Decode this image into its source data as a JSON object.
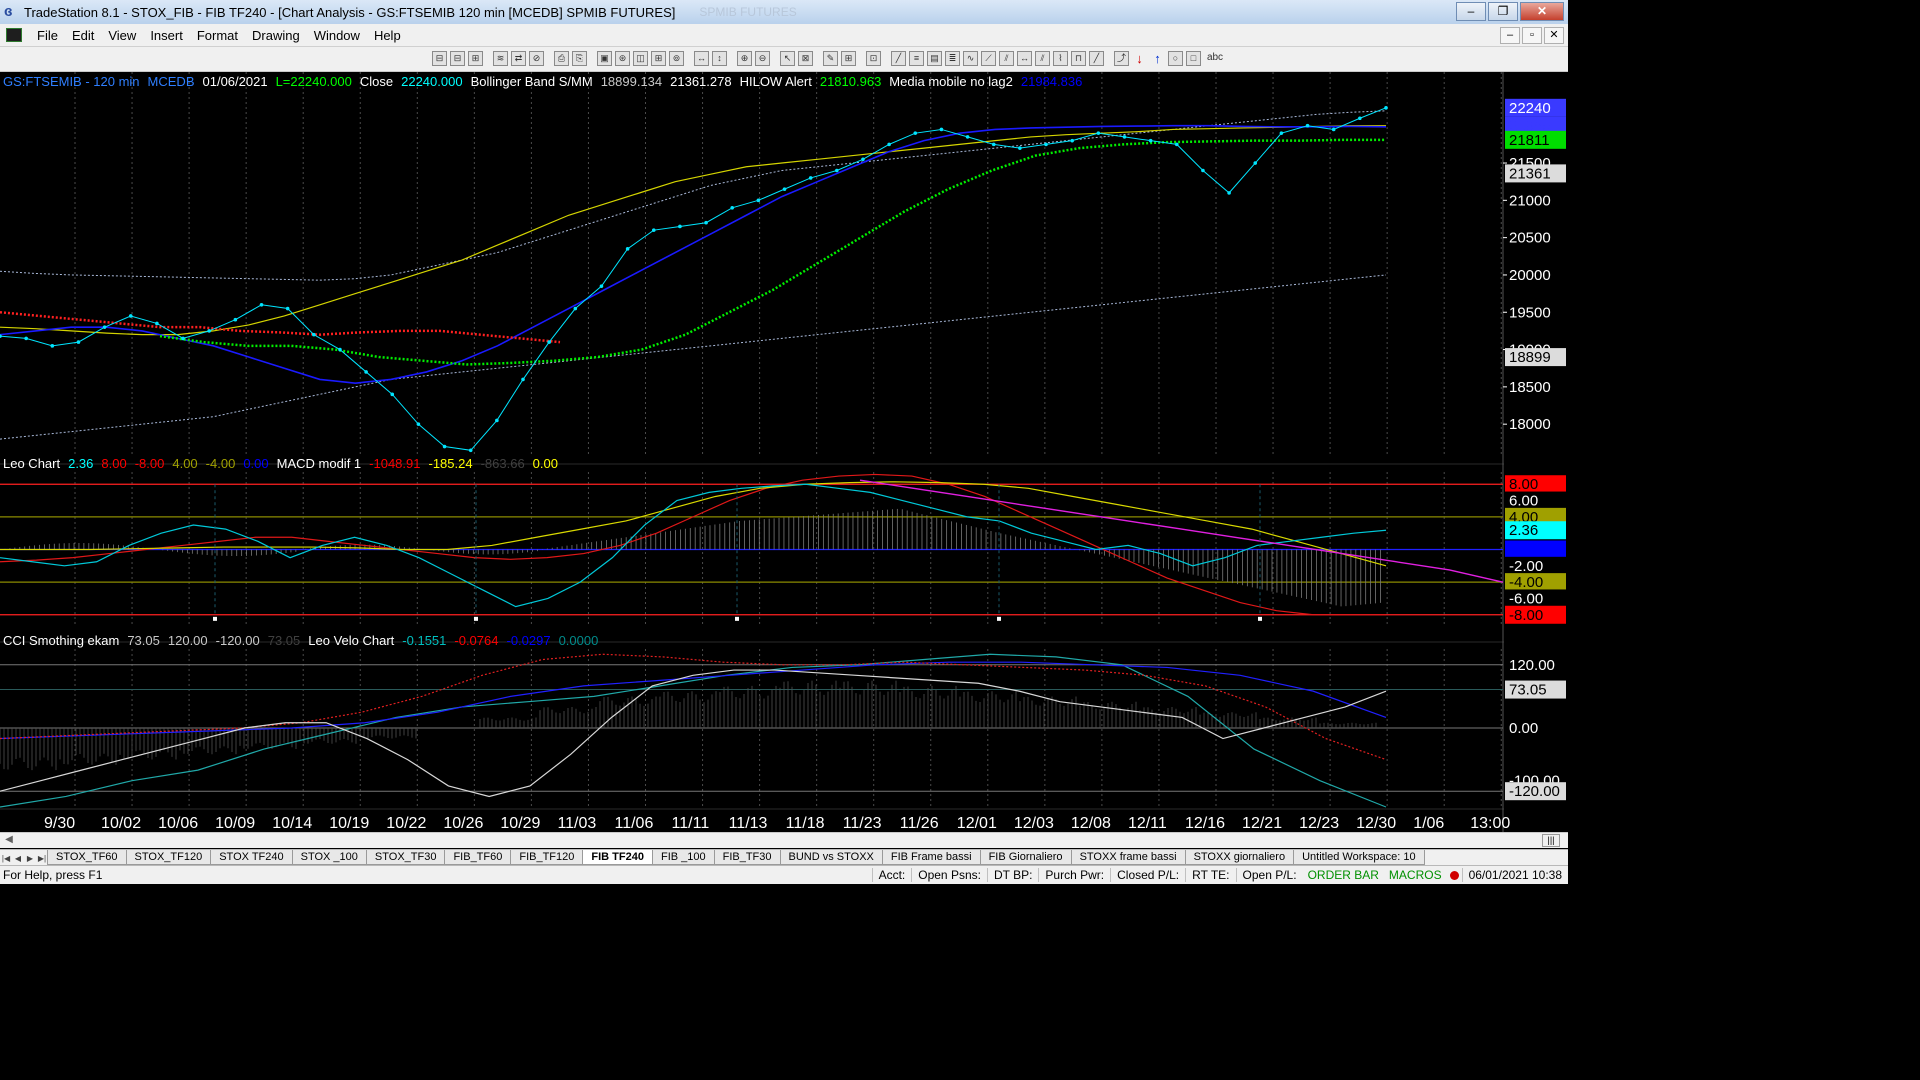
{
  "window": {
    "title": "TradeStation 8.1 - STOX_FIB - FIB TF240 - [Chart Analysis - GS:FTSEMIB  120 min  [MCEDB] SPMIB FUTURES]",
    "ghost_text": "SPMIB FUTURES",
    "min": "–",
    "max": "❐",
    "close": "✕"
  },
  "menu": {
    "items": [
      "File",
      "Edit",
      "View",
      "Insert",
      "Format",
      "Drawing",
      "Window",
      "Help"
    ],
    "mdi": [
      "–",
      "▫",
      "✕"
    ]
  },
  "toolbar": {
    "icons": [
      "⊟",
      "⊟",
      "⊞",
      "sep",
      "≋",
      "⇄",
      "⊘",
      "sep",
      "⎙",
      "⎘",
      "sep",
      "▣",
      "⊛",
      "◫",
      "⊞",
      "⊚",
      "sep",
      "↔",
      "↕",
      "sep",
      "⊕",
      "⊖",
      "sep",
      "↖",
      "⊠",
      "sep",
      "✎",
      "⊞",
      "sep",
      "⊡",
      "sep",
      "╱",
      "≡",
      "▤",
      "≣",
      "∿",
      "⟋",
      "⫽",
      "↔",
      "⫽",
      "⌇",
      "⊓",
      "╱",
      "sep",
      "⤴",
      "↓",
      "↑",
      "○",
      "□",
      "abc"
    ]
  },
  "price_panel": {
    "header": [
      {
        "text": "GS:FTSEMIB - 120 min",
        "color": "#2f7fff"
      },
      {
        "text": "MCEDB",
        "color": "#2f7fff"
      },
      {
        "text": "01/06/2021",
        "color": "#ffffff"
      },
      {
        "text": "L=22240.000",
        "color": "#00ff00"
      },
      {
        "text": "Close",
        "color": "#ffffff"
      },
      {
        "text": "22240.000",
        "color": "#00ffff"
      },
      {
        "text": "Bollinger Band S/MM",
        "color": "#ffffff"
      },
      {
        "text": "18899.134",
        "color": "#c8c8c8"
      },
      {
        "text": "21361.278",
        "color": "#ffffff"
      },
      {
        "text": "HILOW Alert",
        "color": "#ffffff"
      },
      {
        "text": "21810.963",
        "color": "#00ff00"
      },
      {
        "text": "Media mobile no lag2",
        "color": "#ffffff"
      },
      {
        "text": "21984.836",
        "color": "#0000ff"
      }
    ],
    "y_ticks": [
      "21500",
      "21000",
      "20500",
      "20000",
      "19500",
      "19000",
      "18500",
      "18000"
    ],
    "y_ticks_vals": [
      21500,
      21000,
      20500,
      20000,
      19500,
      19000,
      18500,
      18000
    ],
    "y_range": [
      17560,
      22720
    ],
    "flags": [
      {
        "text": "22240",
        "bg": "#3a3aff",
        "fg": "#ffffff",
        "v": 22240
      },
      {
        "text": "21985",
        "bg": "#3a3aff",
        "fg": "#3a3aff",
        "v": 22000
      },
      {
        "text": "21811",
        "bg": "#00dd00",
        "fg": "#000000",
        "v": 21811
      },
      {
        "text": "21361",
        "bg": "#dcdcdc",
        "fg": "#000000",
        "v": 21361
      },
      {
        "text": "18899",
        "bg": "#dcdcdc",
        "fg": "#000000",
        "v": 18899
      }
    ]
  },
  "osc_panel": {
    "header": [
      {
        "text": "Leo Chart",
        "color": "#ffffff"
      },
      {
        "text": "2.36",
        "color": "#00ffff"
      },
      {
        "text": "8.00",
        "color": "#ff0000"
      },
      {
        "text": "-8.00",
        "color": "#ff0000"
      },
      {
        "text": "4.00",
        "color": "#a0a000"
      },
      {
        "text": "-4.00",
        "color": "#a0a000"
      },
      {
        "text": "0.00",
        "color": "#0000ff"
      },
      {
        "text": "MACD modif 1",
        "color": "#ffffff"
      },
      {
        "text": "-1048.91",
        "color": "#ff0000"
      },
      {
        "text": "-185.24",
        "color": "#ffff00"
      },
      {
        "text": "-863.66",
        "color": "#404040"
      },
      {
        "text": "0.00",
        "color": "#ffff00"
      }
    ],
    "y_range": [
      -9.5,
      9.5
    ],
    "flags": [
      {
        "text": "8.00",
        "bg": "#ff0000",
        "fg": "#000000",
        "v": 8
      },
      {
        "text": "6.00",
        "bg": "#000000",
        "fg": "#ffffff",
        "v": 6
      },
      {
        "text": "4.00",
        "bg": "#a0a000",
        "fg": "#000000",
        "v": 4
      },
      {
        "text": "2.36",
        "bg": "#00ffff",
        "fg": "#000000",
        "v": 2.36
      },
      {
        "text": "0.00",
        "bg": "#0000ff",
        "fg": "#0000ff",
        "v": 0
      },
      {
        "text": "-2.00",
        "bg": "#000000",
        "fg": "#ffffff",
        "v": -2
      },
      {
        "text": "-4.00",
        "bg": "#a0a000",
        "fg": "#000000",
        "v": -4
      },
      {
        "text": "-6.00",
        "bg": "#000000",
        "fg": "#ffffff",
        "v": -6
      },
      {
        "text": "-8.00",
        "bg": "#ff0000",
        "fg": "#000000",
        "v": -8
      }
    ]
  },
  "cci_panel": {
    "header": [
      {
        "text": "CCI Smothing ekam",
        "color": "#ffffff"
      },
      {
        "text": "73.05",
        "color": "#c8c8c8"
      },
      {
        "text": "120.00",
        "color": "#c8c8c8"
      },
      {
        "text": "-120.00",
        "color": "#c8c8c8"
      },
      {
        "text": "73.05",
        "color": "#404040"
      },
      {
        "text": "Leo Velo Chart",
        "color": "#ffffff"
      },
      {
        "text": "-0.1551",
        "color": "#00bfbf"
      },
      {
        "text": "-0.0764",
        "color": "#ff0000"
      },
      {
        "text": "-0.0297",
        "color": "#0000ff"
      },
      {
        "text": "0.0000",
        "color": "#008b8b"
      }
    ],
    "y_range": [
      -150,
      150
    ],
    "flags": [
      {
        "text": "120.00",
        "bg": "#000000",
        "fg": "#ffffff",
        "v": 120
      },
      {
        "text": "73.05",
        "bg": "#dcdcdc",
        "fg": "#000000",
        "v": 73
      },
      {
        "text": "0.00",
        "bg": "#000000",
        "fg": "#ffffff",
        "v": 0
      },
      {
        "text": "-100.00",
        "bg": "#000000",
        "fg": "#ffffff",
        "v": -100
      },
      {
        "text": "-120.00",
        "bg": "#dcdcdc",
        "fg": "#000000",
        "v": -120
      }
    ]
  },
  "x_axis": {
    "labels": [
      "9/30",
      "10/02",
      "10/06",
      "10/09",
      "10/14",
      "10/19",
      "10/22",
      "10/26",
      "10/29",
      "11/03",
      "11/06",
      "11/11",
      "11/13",
      "11/18",
      "11/23",
      "11/26",
      "12/01",
      "12/03",
      "12/08",
      "12/11",
      "12/16",
      "12/21",
      "12/23",
      "12/30",
      "1/06",
      "13:00"
    ]
  },
  "series": {
    "close": [
      19180,
      19150,
      19050,
      19100,
      19300,
      19450,
      19350,
      19150,
      19250,
      19400,
      19600,
      19550,
      19200,
      19000,
      18700,
      18400,
      18000,
      17700,
      17650,
      18050,
      18600,
      19100,
      19550,
      19850,
      20350,
      20600,
      20650,
      20700,
      20900,
      21000,
      21150,
      21300,
      21400,
      21550,
      21750,
      21900,
      21950,
      21850,
      21750,
      21700,
      21750,
      21800,
      21900,
      21850,
      21800,
      21750,
      21400,
      21100,
      21500,
      21900,
      22000,
      21950,
      22100,
      22240
    ],
    "bb_mid": [
      19300,
      19280,
      19250,
      19220,
      19200,
      19200,
      19250,
      19330,
      19450,
      19600,
      19750,
      19900,
      20050,
      20200,
      20400,
      20600,
      20800,
      20950,
      21100,
      21250,
      21350,
      21450,
      21500,
      21550,
      21600,
      21650,
      21700,
      21750,
      21800,
      21850,
      21880,
      21900,
      21920,
      21950,
      21960,
      21970,
      21980,
      21990,
      22000,
      22000
    ],
    "bb_low": [
      17800,
      17850,
      17900,
      17950,
      18000,
      18050,
      18100,
      18200,
      18300,
      18400,
      18500,
      18600,
      18650,
      18700,
      18750,
      18800,
      18850,
      18900,
      18950,
      19000,
      19050,
      19100,
      19150,
      19200,
      19250,
      19300,
      19350,
      19400,
      19450,
      19500,
      19550,
      19600,
      19650,
      19700,
      19750,
      19800,
      19850,
      19900,
      19950,
      20000
    ],
    "bb_up": [
      20050,
      20020,
      20000,
      19990,
      19980,
      19970,
      19960,
      19950,
      19940,
      19930,
      19950,
      20000,
      20100,
      20200,
      20300,
      20450,
      20600,
      20750,
      20900,
      21050,
      21200,
      21300,
      21400,
      21450,
      21500,
      21550,
      21600,
      21650,
      21700,
      21750,
      21800,
      21850,
      21900,
      21950,
      22000,
      22050,
      22100,
      22150,
      22180,
      22200
    ],
    "mm_nolag": [
      19200,
      19250,
      19300,
      19300,
      19250,
      19150,
      19050,
      18900,
      18750,
      18600,
      18550,
      18600,
      18700,
      18850,
      19050,
      19300,
      19550,
      19800,
      20050,
      20300,
      20550,
      20800,
      21050,
      21250,
      21450,
      21650,
      21800,
      21900,
      21950,
      21970,
      21980,
      21990,
      21995,
      22000,
      22000,
      21990,
      21985,
      21985,
      21990,
      21985
    ],
    "hilow_red": [
      19500,
      19450,
      19400,
      19350,
      19300,
      19300,
      19250,
      19230,
      19200,
      19230,
      19250,
      19250,
      19200,
      19150,
      19100
    ],
    "hilow_green": [
      19180,
      19100,
      19050,
      19050,
      19000,
      18900,
      18850,
      18800,
      18820,
      18850,
      18900,
      19000,
      19200,
      19500,
      19800,
      20150,
      20500,
      20850,
      21150,
      21400,
      21600,
      21700,
      21750,
      21780,
      21790,
      21800,
      21800,
      21810,
      21811
    ]
  },
  "osc_series": {
    "leo": [
      -1,
      -1.5,
      -2,
      -1.5,
      0.5,
      2,
      3,
      2.5,
      1,
      -1,
      0.5,
      1.5,
      0.5,
      -1,
      -3,
      -5,
      -7,
      -6,
      -4,
      -1,
      3,
      6,
      7,
      7.5,
      7.8,
      8,
      7.5,
      7,
      6,
      5,
      4,
      3.5,
      2,
      1,
      0,
      0.5,
      -0.5,
      -2,
      -1,
      0.5,
      1,
      1.5,
      2,
      2.36
    ],
    "red": [
      -1.5,
      -1.3,
      -1,
      -0.5,
      0,
      0.5,
      1,
      1.5,
      1.5,
      1,
      0.5,
      0,
      -0.5,
      -1,
      -1.2,
      -1,
      -0.5,
      0.5,
      2,
      4,
      6,
      7.5,
      8.5,
      9,
      9.2,
      9,
      8,
      6.5,
      4.5,
      2.5,
      0.5,
      -1.5,
      -3.5,
      -5,
      -6.5,
      -7.5,
      -8,
      -8,
      -8
    ],
    "yellow": [
      0,
      0,
      0,
      0.1,
      0.2,
      0.3,
      0.3,
      0.3,
      0.2,
      0,
      0,
      0.5,
      1.5,
      2.5,
      3.5,
      5,
      6.5,
      7.5,
      8,
      8.2,
      8.3,
      8.2,
      8,
      7.5,
      6.5,
      5.5,
      4.5,
      3.5,
      2.5,
      1,
      -0.5,
      -2
    ],
    "magenta": [
      8.5,
      7.5,
      6.5,
      5.5,
      4.5,
      3.5,
      2.5,
      1.5,
      0.5,
      -0.5,
      -1.5,
      -2.5,
      -4
    ]
  },
  "cci_series": {
    "white": [
      -120,
      -100,
      -80,
      -60,
      -40,
      -20,
      0,
      10,
      10,
      -20,
      -60,
      -110,
      -130,
      -110,
      -50,
      20,
      80,
      100,
      110,
      110,
      105,
      100,
      95,
      90,
      85,
      70,
      50,
      40,
      30,
      20,
      -20,
      0,
      20,
      40,
      70
    ],
    "red": [
      -20,
      -15,
      -10,
      -5,
      0,
      10,
      30,
      60,
      100,
      130,
      140,
      135,
      125,
      120,
      120,
      125,
      120,
      115,
      110,
      100,
      80,
      40,
      -20,
      -60
    ],
    "blue": [
      -20,
      -15,
      -10,
      -5,
      0,
      10,
      30,
      60,
      80,
      90,
      100,
      110,
      120,
      125,
      125,
      120,
      115,
      100,
      70,
      20
    ],
    "teal": [
      -150,
      -130,
      -100,
      -80,
      -40,
      -10,
      20,
      40,
      50,
      60,
      80,
      100,
      115,
      120,
      130,
      140,
      135,
      120,
      60,
      -40,
      -100,
      -150
    ],
    "histogram": [
      -80,
      -70,
      -60,
      -50,
      -40,
      -30,
      -20,
      0,
      20,
      40,
      60,
      70,
      80,
      90,
      90,
      80,
      70,
      60,
      50,
      40,
      30,
      20,
      10
    ]
  },
  "tabs": [
    "STOX_TF60",
    "STOX_TF120",
    "STOX TF240",
    "STOX _100",
    "STOX_TF30",
    "FIB_TF60",
    "FIB_TF120",
    "FIB TF240",
    "FIB _100",
    "FIB_TF30",
    "BUND vs STOXX",
    "FIB Frame bassi",
    "FIB Giornaliero",
    "STOXX frame bassi",
    "STOXX giornaliero",
    "Untitled Workspace:  10"
  ],
  "active_tab": "FIB TF240",
  "status": {
    "help": "For Help, press F1",
    "fields": [
      "Acct:",
      "Open Psns:",
      "DT BP:",
      "Purch Pwr:",
      "Closed P/L:",
      "RT TE:",
      "Open P/L:"
    ],
    "order_bar": "ORDER BAR",
    "macros": "MACROS",
    "datetime": "06/01/2021 10:38"
  },
  "colors": {
    "grid": "#4a4a4a",
    "close": "#00e5ff",
    "bb_mid": "#d4d400",
    "bb_band": "#a8b8d8",
    "mm": "#1a1aff",
    "hilow_red": "#ff2020",
    "hilow_green": "#00ee00"
  }
}
